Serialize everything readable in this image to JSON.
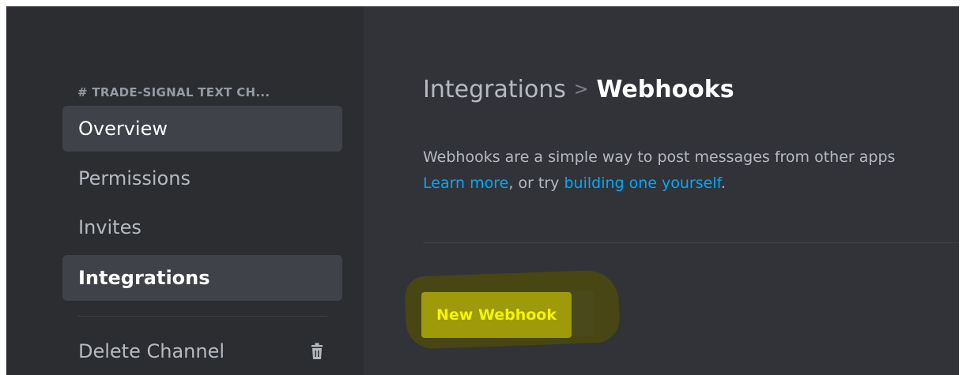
{
  "sidebar": {
    "header": "# TRADE-SIGNAL  TEXT CH...",
    "items": [
      {
        "label": "Overview"
      },
      {
        "label": "Permissions"
      },
      {
        "label": "Invites"
      },
      {
        "label": "Integrations"
      }
    ],
    "delete_label": "Delete Channel"
  },
  "main": {
    "breadcrumb_parent": "Integrations",
    "breadcrumb_separator": ">",
    "breadcrumb_current": "Webhooks",
    "description_line1": "Webhooks are a simple way to post messages from other apps",
    "learn_more": "Learn more",
    "middle_text": ", or try ",
    "build_link": "building one yourself",
    "end_text": ".",
    "new_webhook_label": "New Webhook"
  },
  "colors": {
    "sidebar_bg": "#2b2d31",
    "main_bg": "#313338",
    "link": "#00a8fc",
    "brand": "#5865f2",
    "highlighter": "#9e9a0a"
  }
}
